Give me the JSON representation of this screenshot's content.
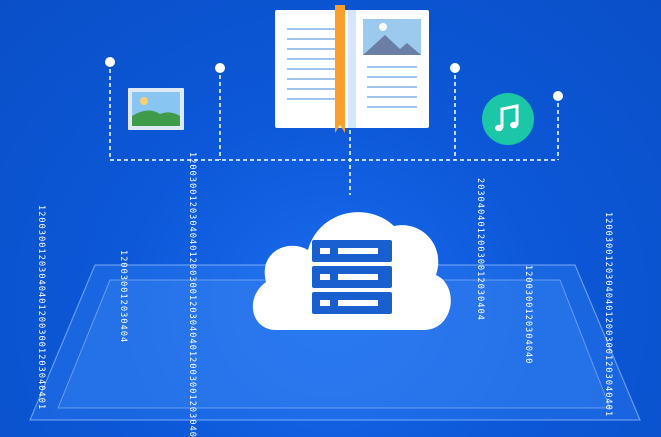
{
  "binary_streams": [
    {
      "id": "s1",
      "text": "120030012030404012003001203040401"
    },
    {
      "id": "s2",
      "text": "1200300120304040120030012030404012003001203040401"
    },
    {
      "id": "s3",
      "text": "120030012030404"
    },
    {
      "id": "s4",
      "text": "20304040120030012030404"
    },
    {
      "id": "s5",
      "text": "1200300120304040"
    },
    {
      "id": "s6",
      "text": "120030012030404012003001203040401"
    }
  ],
  "icons": {
    "book": "open-book-icon",
    "image": "image-icon",
    "music": "music-note-icon",
    "cloud": "cloud-server-icon"
  },
  "colors": {
    "background": "#0b56d6",
    "accent_orange": "#f7a030",
    "music_teal": "#1cc7a8",
    "server_blue": "#1a5fd0"
  }
}
